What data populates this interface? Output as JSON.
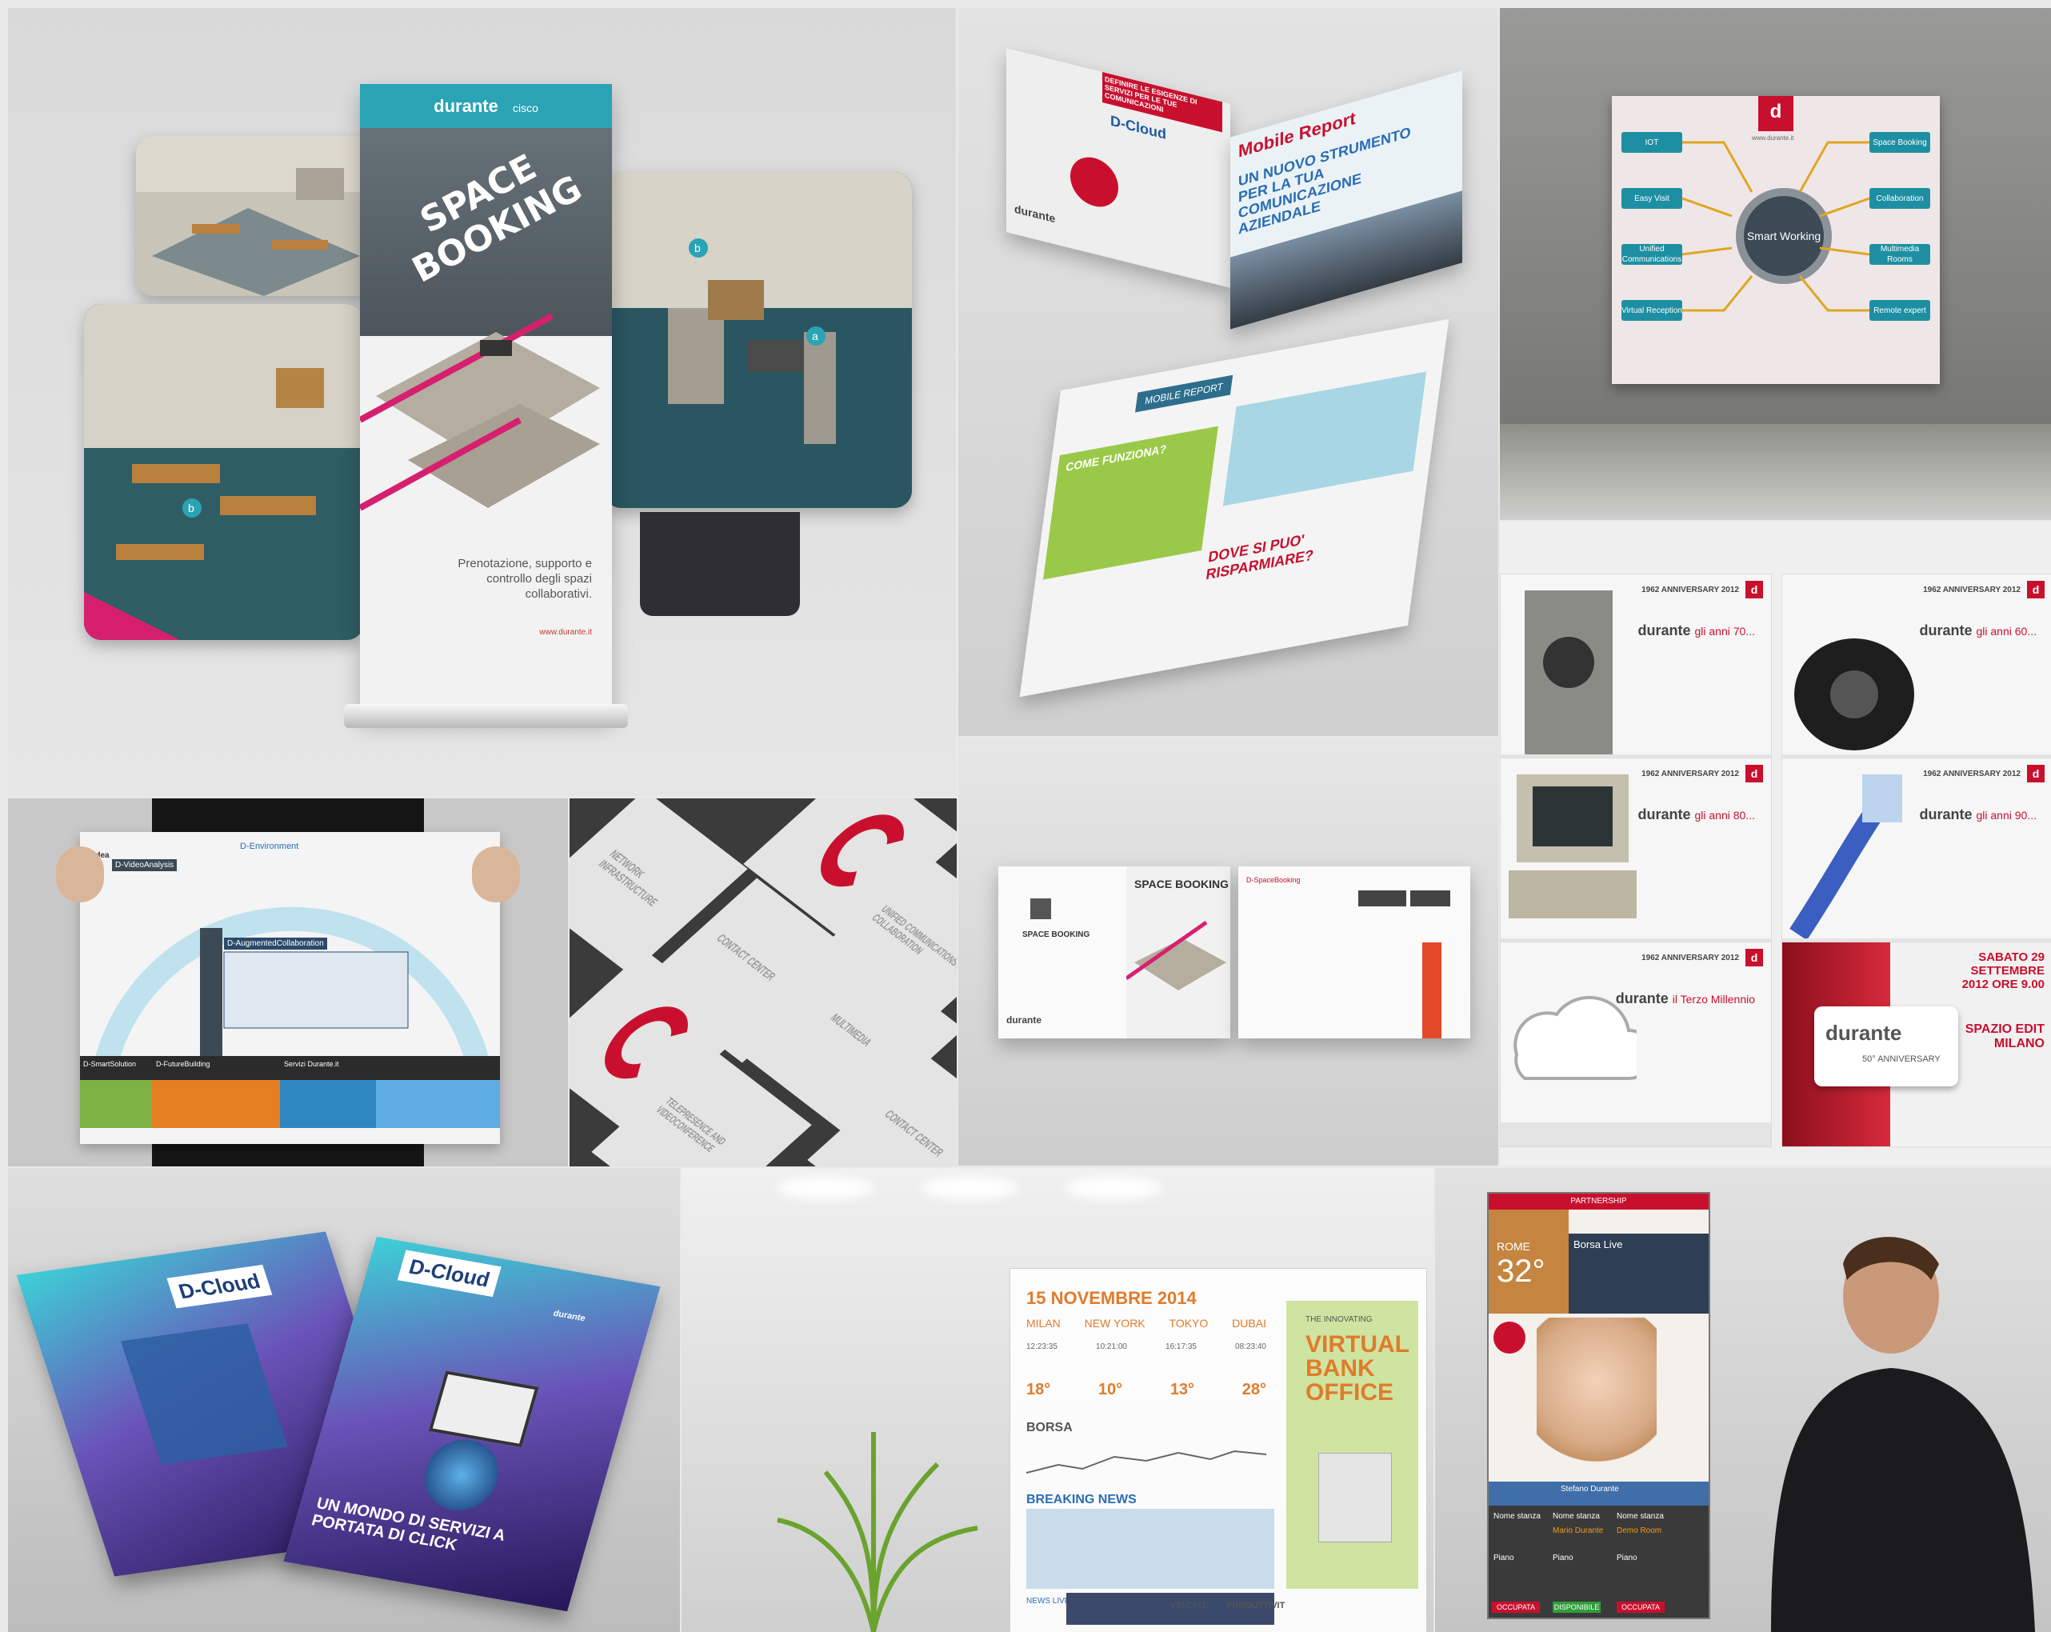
{
  "tile1": {
    "banner_brand": "durante",
    "banner_partner": "cisco",
    "banner_title": "SPACE BOOKING",
    "banner_text": "Prenotazione, supporto e controllo degli spazi collaborativi.",
    "banner_url": "www.durante.it",
    "badge_a": "a",
    "badge_b": "b"
  },
  "tile2": {
    "red_header": "DEFINIRE LE ESIGENZE DI SERVIZI PER LE TUE COMUNICAZIONI",
    "dcloud": "D-Cloud",
    "mobile_report": "Mobile Report",
    "headline": "UN NUOVO STRUMENTO PER LA TUA COMUNICAZIONE AZIENDALE",
    "brand": "durante",
    "inner_tab1": "MOBILE REPORT",
    "inner_tab2": "COME FUNZIONA?",
    "inner_question": "DOVE SI PUO' RISPARMIARE?"
  },
  "tile3": {
    "hub": "Smart Working",
    "left_tags": [
      "IOT",
      "Easy Visit",
      "Unified Communications",
      "Virtual Reception"
    ],
    "right_tags": [
      "Space Booking",
      "Collaboration",
      "Multimedia Rooms",
      "Remote expert"
    ],
    "url": "www.durante.it"
  },
  "tile4": {
    "year": "1962 ANNIVERSARY 2012",
    "slides": [
      {
        "brand": "durante",
        "text": "gli anni 70..."
      },
      {
        "brand": "durante",
        "text": "gli anni 60..."
      },
      {
        "brand": "durante",
        "text": "gli anni 80..."
      },
      {
        "brand": "durante",
        "text": "gli anni 90..."
      },
      {
        "brand": "durante",
        "text": "il Terzo Millennio"
      }
    ],
    "event_date": "SABATO 29 SETTEMBRE 2012 ORE 9.00",
    "event_place": "SPAZIO EDIT MILANO",
    "anniversary": "50° ANNIVERSARY"
  },
  "tile5": {
    "top_box": "D-Environment",
    "left_label": "D-Idea",
    "sub1": "D-VideoAnalysis",
    "sub2": "D-AugmentedCollaboration",
    "bottom": [
      "D-SmartSolution",
      "D-FutureBuilding",
      "Servizi Durante.it"
    ]
  },
  "tile6": {
    "labels": [
      "NETWORK INFRASTRUCTURE",
      "CONTACT CENTER",
      "UNIFIED COMMUNICATIONS & COLLABORATION",
      "MULTIMEDIA",
      "TELEPRESENCE AND VIDEOCONFERENCE",
      "CONTACT CENTER"
    ]
  },
  "tile7": {
    "title": "SPACE BOOKING",
    "brand": "durante",
    "panel_title": "D-SpaceBooking"
  },
  "tile8": {
    "brand_back": "D-Cloud",
    "brand_front": "D-Cloud",
    "small_brand": "durante",
    "tagline": "UN MONDO DI SERVIZI A PORTATA DI CLICK"
  },
  "tile9": {
    "date": "15 NOVEMBRE 2014",
    "cities": [
      "MILAN",
      "NEW YORK",
      "TOKYO",
      "DUBAI"
    ],
    "times": [
      "12:23:35",
      "10:21:00",
      "16:17:35",
      "08:23:40"
    ],
    "temps": [
      "18°",
      "10°",
      "13°",
      "28°"
    ],
    "borsa": "BORSA",
    "breaking": "BREAKING NEWS",
    "news_live": "NEWS LIVE",
    "bank_pre": "THE INNOVATING",
    "bank_title": "VIRTUAL BANK OFFICE",
    "bottom_words": [
      "VENDITE",
      "PRODUTTIVIT"
    ]
  },
  "tile10": {
    "partnership": "PARTNERSHIP",
    "city": "ROME",
    "temp": "32°",
    "borsa": "Borsa Live",
    "person": "Stefano Durante",
    "rows": [
      {
        "label": "Nome stanza",
        "value": "Mario Durante"
      },
      {
        "label": "Nome stanza",
        "value": "Demo Room"
      }
    ],
    "piano": "Piano",
    "statuses": [
      "OCCUPATA",
      "DISPONIBILE",
      "OCCUPATA"
    ]
  },
  "colors": {
    "brand_red": "#c8102e",
    "teal": "#2aa3b5",
    "magenta": "#d6206f",
    "orange": "#e07b2b"
  }
}
